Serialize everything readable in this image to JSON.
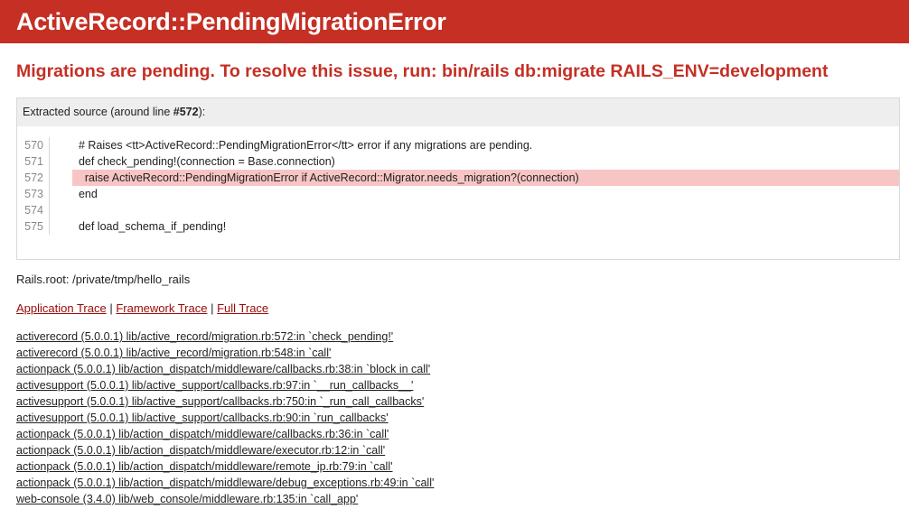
{
  "header": {
    "title": "ActiveRecord::PendingMigrationError"
  },
  "message": "Migrations are pending. To resolve this issue, run: bin/rails db:migrate RAILS_ENV=development",
  "source": {
    "title_prefix": "Extracted source (around line ",
    "line_ref": "#572",
    "title_suffix": "):",
    "lines": [
      {
        "no": "570",
        "code": "  # Raises <tt>ActiveRecord::PendingMigrationError</tt> error if any migrations are pending."
      },
      {
        "no": "571",
        "code": "  def check_pending!(connection = Base.connection)"
      },
      {
        "no": "572",
        "code": "    raise ActiveRecord::PendingMigrationError if ActiveRecord::Migrator.needs_migration?(connection)"
      },
      {
        "no": "573",
        "code": "  end"
      },
      {
        "no": "574",
        "code": ""
      },
      {
        "no": "575",
        "code": "  def load_schema_if_pending!"
      }
    ],
    "highlight_line": "572"
  },
  "rails_root": "Rails.root: /private/tmp/hello_rails",
  "trace_links": {
    "application": "Application Trace",
    "framework": "Framework Trace",
    "full": "Full Trace",
    "separator": " | "
  },
  "trace": [
    "activerecord (5.0.0.1) lib/active_record/migration.rb:572:in `check_pending!'",
    "activerecord (5.0.0.1) lib/active_record/migration.rb:548:in `call'",
    "actionpack (5.0.0.1) lib/action_dispatch/middleware/callbacks.rb:38:in `block in call'",
    "activesupport (5.0.0.1) lib/active_support/callbacks.rb:97:in `__run_callbacks__'",
    "activesupport (5.0.0.1) lib/active_support/callbacks.rb:750:in `_run_call_callbacks'",
    "activesupport (5.0.0.1) lib/active_support/callbacks.rb:90:in `run_callbacks'",
    "actionpack (5.0.0.1) lib/action_dispatch/middleware/callbacks.rb:36:in `call'",
    "actionpack (5.0.0.1) lib/action_dispatch/middleware/executor.rb:12:in `call'",
    "actionpack (5.0.0.1) lib/action_dispatch/middleware/remote_ip.rb:79:in `call'",
    "actionpack (5.0.0.1) lib/action_dispatch/middleware/debug_exceptions.rb:49:in `call'",
    "web-console (3.4.0) lib/web_console/middleware.rb:135:in `call_app'"
  ],
  "colors": {
    "header_bg": "#c52f24",
    "message_text": "#c52f24",
    "highlight_bg": "#f8c5c5",
    "link": "#980905"
  }
}
